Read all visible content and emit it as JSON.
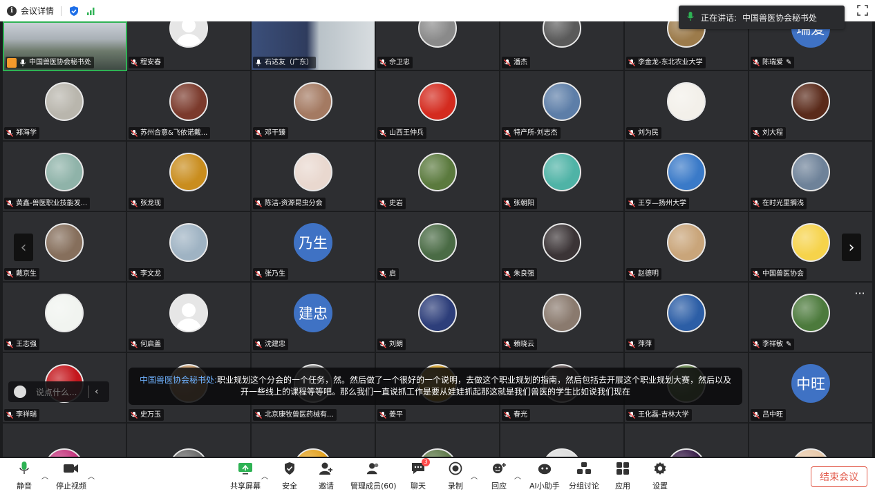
{
  "topbar": {
    "meeting_details_label": "会议详情"
  },
  "speaking": {
    "label": "正在讲话:",
    "name": "中国兽医协会秘书处"
  },
  "participants": [
    [
      {
        "name": "中国兽医协会秘书处",
        "kind": "video",
        "host": true
      },
      {
        "name": "程安春",
        "kind": "gray"
      },
      {
        "name": "石达友（广东）",
        "kind": "video2"
      },
      {
        "name": "佘卫忠",
        "kind": "photo",
        "bg": "#8a8a8a"
      },
      {
        "name": "潘杰",
        "kind": "photo",
        "bg": "#5a5a5a"
      },
      {
        "name": "李金龙-东北农业大学",
        "kind": "photo",
        "bg": "#9c7b4b"
      },
      {
        "name": "陈瑞爱",
        "kind": "text",
        "initials": "瑞爱",
        "pencil": true
      }
    ],
    [
      {
        "name": "郑海学",
        "kind": "photo",
        "bg": "#b9b6ad"
      },
      {
        "name": "苏州合意&飞依诺戴...",
        "kind": "photo",
        "bg": "#7b3a2c"
      },
      {
        "name": "邓干臻",
        "kind": "photo",
        "bg": "#a47a62"
      },
      {
        "name": "山西王仲兵",
        "kind": "photo",
        "bg": "#d42b1f"
      },
      {
        "name": "特产所-刘志杰",
        "kind": "photo",
        "bg": "#5d7ea8"
      },
      {
        "name": "刘为民",
        "kind": "photo",
        "bg": "#f3f0ea"
      },
      {
        "name": "刘大程",
        "kind": "photo",
        "bg": "#5a2a1a"
      }
    ],
    [
      {
        "name": "黄鑫-兽医职业技能发...",
        "kind": "photo",
        "bg": "#8fb3a9"
      },
      {
        "name": "张龙现",
        "kind": "photo",
        "bg": "#c98d1e"
      },
      {
        "name": "陈洁-资源昆虫分会",
        "kind": "photo",
        "bg": "#e9d8cf"
      },
      {
        "name": "史岩",
        "kind": "photo",
        "bg": "#5b7a3e"
      },
      {
        "name": "张朝阳",
        "kind": "photo",
        "bg": "#4fb3a6"
      },
      {
        "name": "王亨—扬州大学",
        "kind": "photo",
        "bg": "#3a7ac8"
      },
      {
        "name": "在时光里搁浅",
        "kind": "photo",
        "bg": "#6e8299"
      }
    ],
    [
      {
        "name": "戴京生",
        "kind": "photo",
        "bg": "#866f5c"
      },
      {
        "name": "李文龙",
        "kind": "photo",
        "bg": "#9fb3c3"
      },
      {
        "name": "张乃生",
        "kind": "text",
        "initials": "乃生"
      },
      {
        "name": "启",
        "kind": "photo",
        "bg": "#4a6b45"
      },
      {
        "name": "朱良强",
        "kind": "photo",
        "bg": "#3b3436"
      },
      {
        "name": "赵德明",
        "kind": "photo",
        "bg": "#c9a57a"
      },
      {
        "name": "中国兽医协会",
        "kind": "photo",
        "bg": "#f6d34b"
      }
    ],
    [
      {
        "name": "王志强",
        "kind": "photo",
        "bg": "#f1f4f0"
      },
      {
        "name": "何启盖",
        "kind": "gray"
      },
      {
        "name": "沈建忠",
        "kind": "text",
        "initials": "建忠"
      },
      {
        "name": "刘朗",
        "kind": "photo",
        "bg": "#2d3e7a"
      },
      {
        "name": "赖晓云",
        "kind": "photo",
        "bg": "#8a7a6e"
      },
      {
        "name": "萍萍",
        "kind": "photo",
        "bg": "#2c5ea6"
      },
      {
        "name": "李祥敏",
        "kind": "photo",
        "bg": "#4c7a3c",
        "pencil": true
      }
    ],
    [
      {
        "name": "李祥瑞",
        "kind": "photo",
        "bg": "#c4161c"
      },
      {
        "name": "史万玉",
        "kind": "photo",
        "bg": "#c79a6b"
      },
      {
        "name": "北京康牧兽医药械有...",
        "kind": "photo",
        "bg": "#7a7a7a"
      },
      {
        "name": "姜平",
        "kind": "photo",
        "bg": "#d4a12a"
      },
      {
        "name": "春光",
        "kind": "photo",
        "bg": "#6a5c5c"
      },
      {
        "name": "王化磊-吉林大学",
        "kind": "photo",
        "bg": "#6a8a4f"
      },
      {
        "name": "吕中旺",
        "kind": "text",
        "initials": "中旺"
      }
    ],
    [
      {
        "name": "",
        "kind": "photo",
        "bg": "#c5377f"
      },
      {
        "name": "",
        "kind": "photo",
        "bg": "#6a6a6a"
      },
      {
        "name": "",
        "kind": "photo",
        "bg": "#e3a21f"
      },
      {
        "name": "",
        "kind": "photo",
        "bg": "#5f7a4a"
      },
      {
        "name": "",
        "kind": "photo",
        "bg": "#ddd"
      },
      {
        "name": "",
        "kind": "photo",
        "bg": "#3a1f4a"
      },
      {
        "name": "",
        "kind": "photo",
        "bg": "#e8c8a8"
      }
    ]
  ],
  "chat": {
    "placeholder": "说点什么..."
  },
  "caption": {
    "speaker": "中国兽医协会秘书处:",
    "text": "职业规划这个分会的一个任务，然。然后做了一个很好的一个说明，去做这个职业规划的指南，然后包括去开展这个职业规划大赛，然后以及开一些线上的课程等等吧。那么我们一直说抓工作是要从娃娃抓起那这就是我们兽医的学生比如说我们现在"
  },
  "toolbar": {
    "mute": "静音",
    "stop_video": "停止视频",
    "share_screen": "共享屏幕",
    "security": "安全",
    "invite": "邀请",
    "manage_members": "管理成员(60)",
    "chat": "聊天",
    "chat_badge": "3",
    "record": "录制",
    "reactions": "回应",
    "ai_assistant": "AI小助手",
    "breakout": "分组讨论",
    "apps": "应用",
    "settings": "设置",
    "end_meeting": "结束会议"
  },
  "colors": {
    "accent_green": "#2eb254",
    "brand_blue": "#3f72c4",
    "end_red": "#e25a4a"
  }
}
